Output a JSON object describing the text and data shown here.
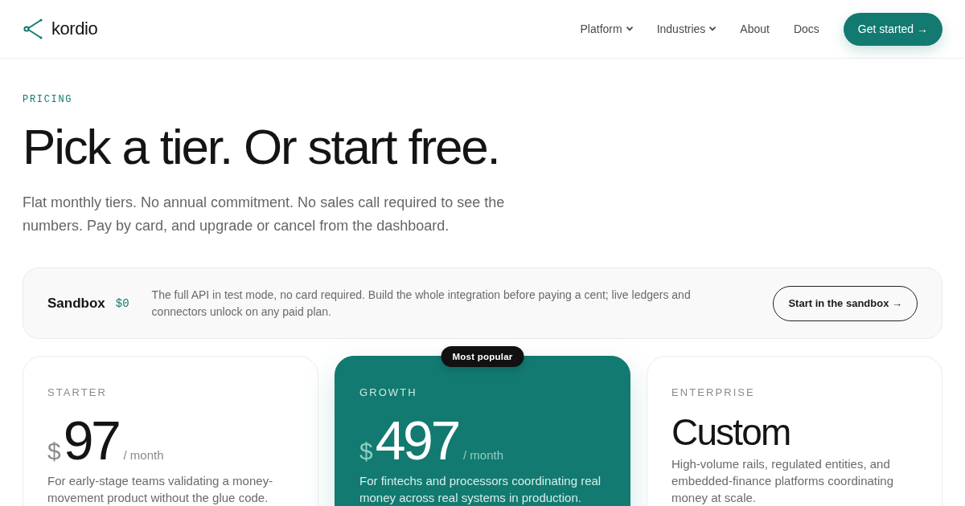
{
  "header": {
    "logo": "kordio",
    "nav": [
      {
        "label": "Platform",
        "kind": "dropdown"
      },
      {
        "label": "Industries",
        "kind": "dropdown"
      },
      {
        "label": "About",
        "kind": "link"
      },
      {
        "label": "Docs",
        "kind": "link"
      }
    ],
    "cta": "Get started →"
  },
  "hero": {
    "eyebrow": "PRICING",
    "title": "Pick a tier. Or start free.",
    "lead": "Flat monthly tiers. No annual commitment. No sales call required to see the numbers. Pay by card, and upgrade or cancel from the dashboard."
  },
  "sandbox": {
    "name": "Sandbox",
    "price": "$0",
    "description": "The full API in test mode, no card required. Build the whole integration before paying a cent; live ledgers and connectors unlock on any paid plan.",
    "button": "Start in the sandbox →"
  },
  "plans": [
    {
      "kind": "priced",
      "name": "STARTER",
      "featured": false,
      "currency": "$",
      "price": "97",
      "period": "/ month",
      "description": "For early-stage teams validating a money-movement product without the glue code."
    },
    {
      "kind": "priced",
      "name": "GROWTH",
      "featured": true,
      "badge": "Most popular",
      "currency": "$",
      "price": "497",
      "period": "/ month",
      "description": "For fintechs and processors coordinating real money across real systems in production."
    },
    {
      "kind": "custom",
      "name": "ENTERPRISE",
      "featured": false,
      "price": "Custom",
      "description": "High-volume rails, regulated entities, and embedded-finance platforms coordinating money at scale."
    }
  ]
}
